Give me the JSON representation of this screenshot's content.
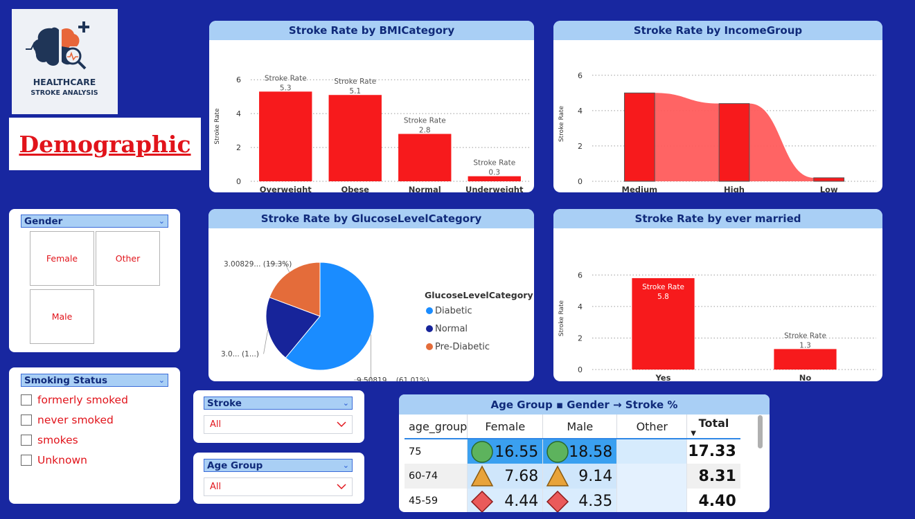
{
  "logo": {
    "line1": "HEALTHCARE",
    "line2": "STROKE ANALYSIS"
  },
  "page_title": "Demographic",
  "colors": {
    "background": "#1827a0",
    "header": "#a9cff5",
    "bar": "#f71a1c",
    "area": "#ff5c5c",
    "diabetic": "#1a8cff",
    "normal": "#17249a",
    "prediabetic": "#e46c3a",
    "slicer_text": "#e1141b"
  },
  "gender_slicer": {
    "title": "Gender",
    "options": [
      "Female",
      "Other",
      "Male"
    ]
  },
  "smoking_slicer": {
    "title": "Smoking Status",
    "options": [
      "formerly smoked",
      "never smoked",
      "smokes",
      "Unknown"
    ]
  },
  "stroke_slicer": {
    "title": "Stroke",
    "value": "All"
  },
  "agegroup_slicer": {
    "title": "Age Group",
    "value": "All"
  },
  "chart_data": [
    {
      "type": "bar",
      "title": "Stroke Rate by BMICategory",
      "xlabel": "BMICategory",
      "ylabel": "Stroke Rate",
      "categories": [
        "Overweight",
        "Obese",
        "Normal",
        "Underweight"
      ],
      "values": [
        5.3,
        5.1,
        2.8,
        0.3
      ],
      "data_label_prefix": "Stroke Rate",
      "yticks": [
        "0",
        "2",
        "4",
        "6"
      ],
      "ylim": [
        0,
        6.5
      ]
    },
    {
      "type": "bar",
      "title": "Stroke Rate by IncomeGroup",
      "xlabel": "IncomeGroup",
      "ylabel": "Stroke Rate",
      "categories": [
        "Medium",
        "High",
        "Low"
      ],
      "values": [
        5.0,
        4.4,
        0.2
      ],
      "yticks": [
        "0",
        "2",
        "4",
        "6"
      ],
      "ylim": [
        0,
        6.5
      ]
    },
    {
      "type": "pie",
      "title": "Stroke Rate by GlucoseLevelCategory",
      "legend_title": "GlucoseLevelCategory",
      "slices": [
        {
          "name": "Diabetic",
          "value": 9.50819,
          "percent": 61.01,
          "label": "9.50819... (61.01%)"
        },
        {
          "name": "Normal",
          "value": 3.0,
          "percent": 19.69,
          "label": "3.0... (1...)"
        },
        {
          "name": "Pre-Diabetic",
          "value": 3.00829,
          "percent": 19.3,
          "label": "3.00829... (19.3%)"
        }
      ]
    },
    {
      "type": "bar",
      "title": "Stroke Rate by ever married",
      "xlabel": "ever married",
      "ylabel": "Stroke Rate",
      "categories": [
        "Yes",
        "No"
      ],
      "values": [
        5.8,
        1.3
      ],
      "data_label_prefix": "Stroke Rate",
      "yticks": [
        "0",
        "2",
        "4",
        "6"
      ],
      "ylim": [
        0,
        6.5
      ]
    },
    {
      "type": "table",
      "title": "Age Group ▪ Gender → Stroke %",
      "columns": [
        "age_group",
        "Female",
        "Male",
        "Other",
        "Total"
      ],
      "rows": [
        {
          "age_group": "75",
          "Female": "16.55",
          "Male": "18.58",
          "Other": "",
          "Total": "17.33",
          "icon": "green-circle-icon"
        },
        {
          "age_group": "60-74",
          "Female": "7.68",
          "Male": "9.14",
          "Other": "",
          "Total": "8.31",
          "icon": "yellow-triangle-icon"
        },
        {
          "age_group": "45-59",
          "Female": "4.44",
          "Male": "4.35",
          "Other": "",
          "Total": "4.40",
          "icon": "red-diamond-icon"
        }
      ]
    }
  ]
}
